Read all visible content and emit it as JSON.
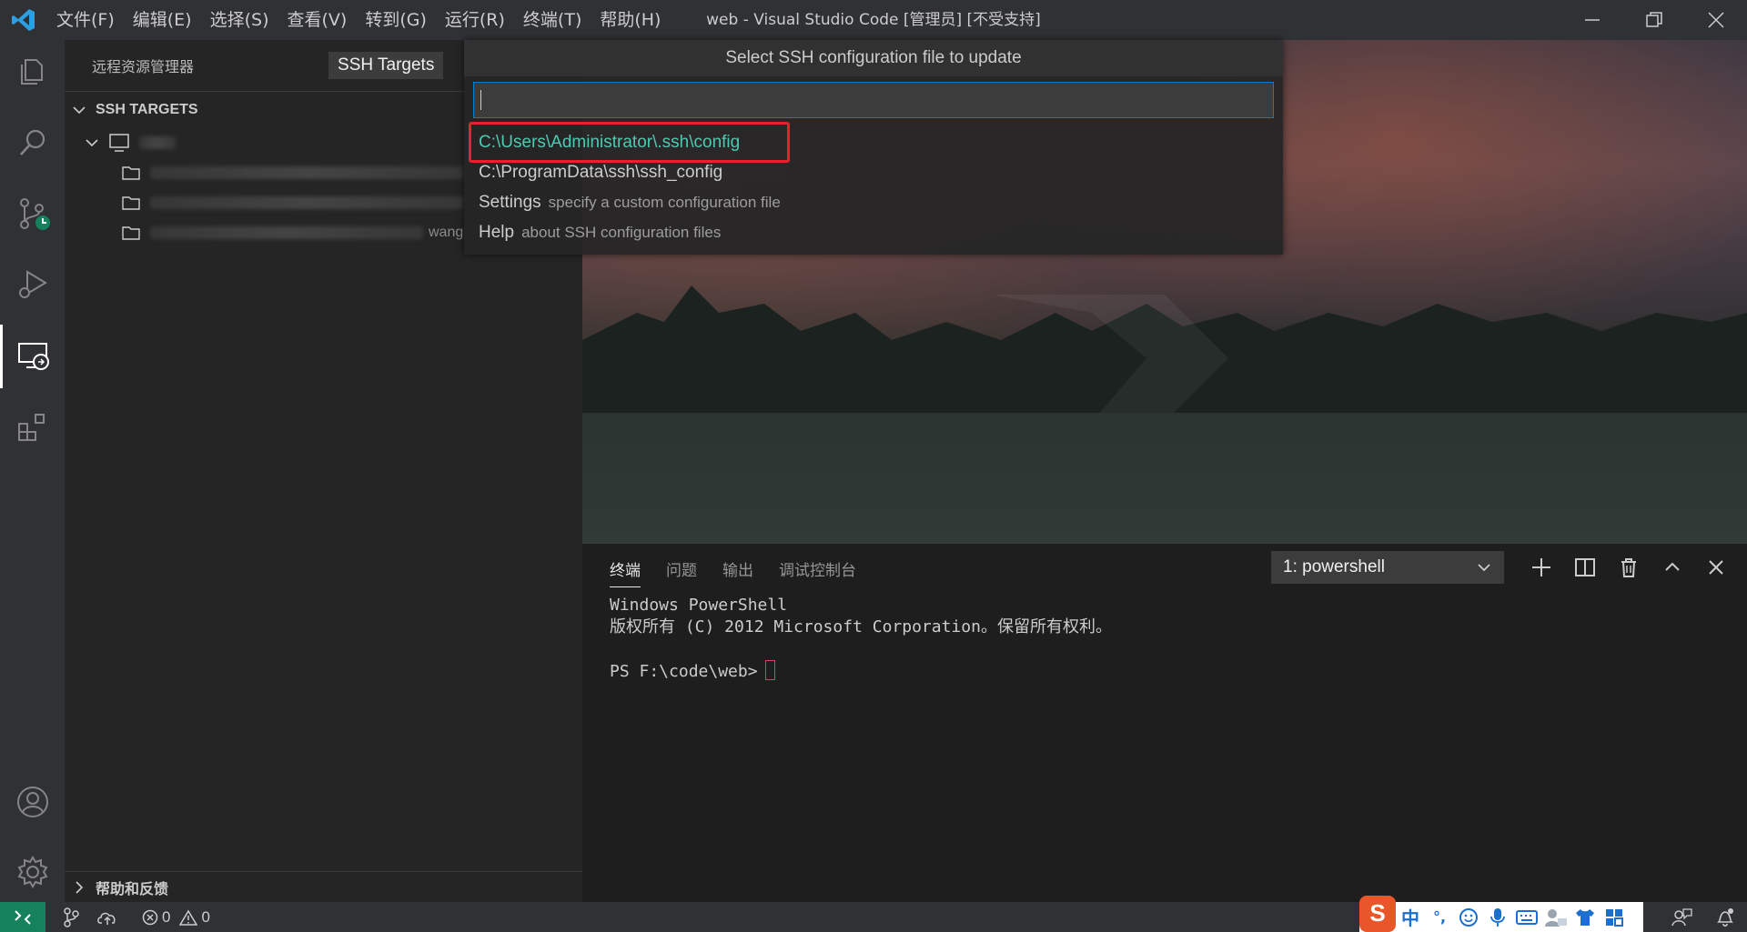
{
  "window": {
    "title": "web - Visual Studio Code [管理员] [不受支持]",
    "menu": [
      "文件(F)",
      "编辑(E)",
      "选择(S)",
      "查看(V)",
      "转到(G)",
      "运行(R)",
      "终端(T)",
      "帮助(H)"
    ]
  },
  "sidebar": {
    "header": "远程资源管理器",
    "targets_dropdown": "SSH Targets",
    "section_title": "SSH TARGETS",
    "folder_suffix": "wang",
    "footer_section": "帮助和反馈"
  },
  "quick_pick": {
    "title": "Select SSH configuration file to update",
    "input_value": "",
    "items": [
      {
        "label": "C:\\Users\\Administrator\\.ssh\\config",
        "description": ""
      },
      {
        "label": "C:\\ProgramData\\ssh\\ssh_config",
        "description": ""
      },
      {
        "label": "Settings",
        "description": "specify a custom configuration file"
      },
      {
        "label": "Help",
        "description": "about SSH configuration files"
      }
    ]
  },
  "panel": {
    "tabs": [
      "终端",
      "问题",
      "输出",
      "调试控制台"
    ],
    "active_tab": "终端",
    "terminal_select": "1: powershell",
    "terminal_lines": [
      "Windows PowerShell",
      "版权所有 (C) 2012 Microsoft Corporation。保留所有权利。",
      "",
      "PS F:\\code\\web>"
    ]
  },
  "statusbar": {
    "errors": "0",
    "warnings": "0"
  },
  "ime": {
    "mode": "中",
    "punct": "°,"
  },
  "colors": {
    "accent": "#007fd4",
    "remote": "#16825d",
    "selected_item": "#4ec9b0",
    "highlight_box": "#e8212a"
  }
}
